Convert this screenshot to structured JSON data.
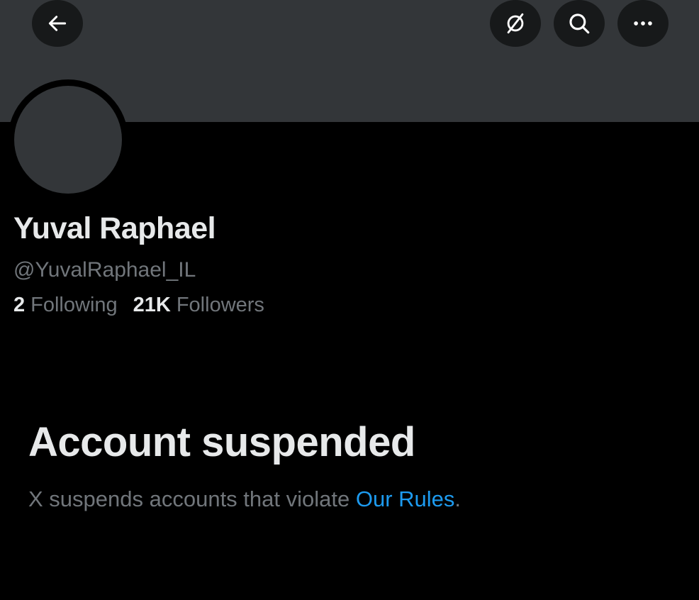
{
  "header": {
    "back_icon": "arrow-left-icon",
    "actions": [
      {
        "name": "grok-icon"
      },
      {
        "name": "search-icon"
      },
      {
        "name": "more-icon"
      }
    ],
    "banner_color": "#333639"
  },
  "profile": {
    "display_name": "Yuval Raphael",
    "handle": "@YuvalRaphael_IL",
    "following_count": "2",
    "following_label": "Following",
    "followers_count": "21K",
    "followers_label": "Followers"
  },
  "notice": {
    "title": "Account suspended",
    "text": "X suspends accounts that violate ",
    "link_text": "Our Rules",
    "trailing": "."
  },
  "colors": {
    "background": "#000000",
    "primary_text": "#e7e9ea",
    "secondary_text": "#71767b",
    "link": "#1d9bf0"
  }
}
